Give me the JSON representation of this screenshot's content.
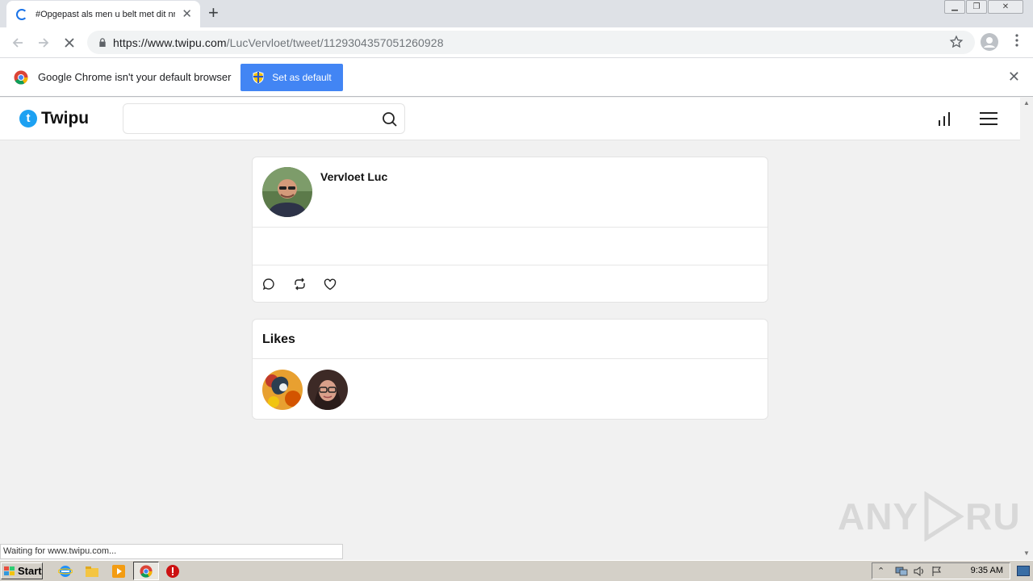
{
  "browser": {
    "tab_title": "#Opgepast als men u belt met dit nr",
    "tab_close": "✕",
    "new_tab": "+",
    "url_host": "https://www.twipu.com",
    "url_path": "/LucVervloet/tweet/1129304357051260928",
    "window_controls": [
      "minimize",
      "restore",
      "close"
    ]
  },
  "infobar": {
    "message": "Google Chrome isn't your default browser",
    "button_label": "Set as default"
  },
  "site": {
    "logo_text": "Twipu",
    "search_value": "",
    "search_placeholder": ""
  },
  "tweet": {
    "author": "Vervloet Luc",
    "body": "",
    "actions": [
      "reply-icon",
      "retweet-icon",
      "like-icon"
    ]
  },
  "likes": {
    "title": "Likes",
    "users": [
      "liker-1",
      "liker-2"
    ]
  },
  "watermark": {
    "text_left": "ANY",
    "text_right": "RUN"
  },
  "status_bar": {
    "text": "Waiting for www.twipu.com..."
  },
  "taskbar": {
    "start_label": "Start",
    "clock": "9:35 AM"
  }
}
